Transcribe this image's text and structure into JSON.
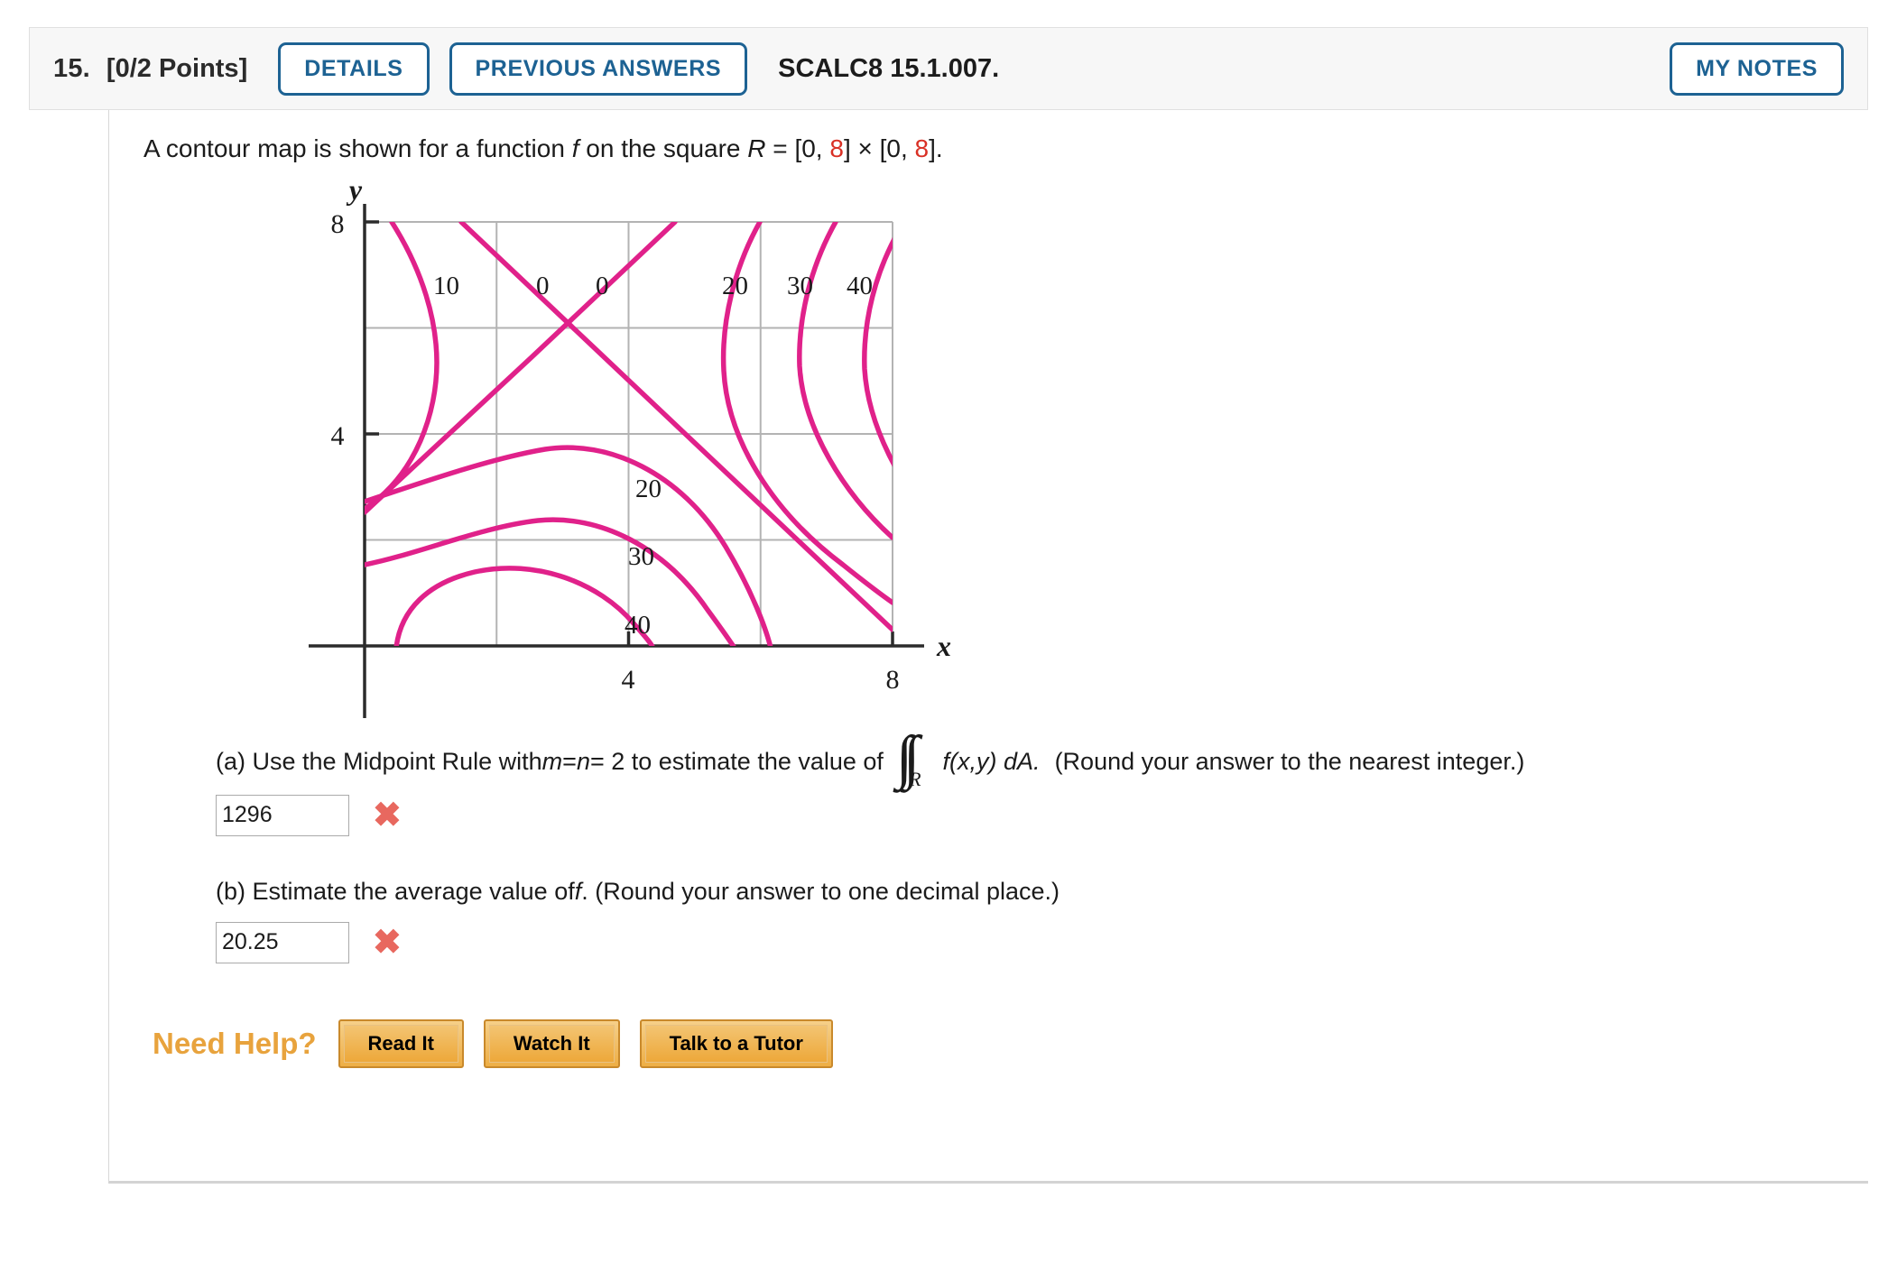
{
  "header": {
    "question_number": "15.",
    "points": "[0/2 Points]",
    "details_label": "DETAILS",
    "previous_answers_label": "PREVIOUS ANSWERS",
    "textbook_code": "SCALC8 15.1.007.",
    "my_notes_label": "MY NOTES"
  },
  "prompt": {
    "part1": "A contour map is shown for a function ",
    "f": "f",
    "part2": " on the square ",
    "R": "R",
    "eq": " = [0, ",
    "hi1": "8",
    "mid": "] × [0, ",
    "hi2": "8",
    "end": "]."
  },
  "chart_data": {
    "type": "contour",
    "title": "",
    "xlabel": "x",
    "ylabel": "y",
    "xlim": [
      0,
      8
    ],
    "ylim": [
      0,
      8
    ],
    "xticks": [
      4,
      8
    ],
    "yticks": [
      4,
      8
    ],
    "xtick_labels": [
      "4",
      "8"
    ],
    "ytick_labels": [
      "4",
      "8"
    ],
    "grid": true,
    "gridlines_x": [
      2,
      4,
      6
    ],
    "gridlines_y": [
      2,
      4,
      6
    ],
    "levels": [
      0,
      10,
      20,
      30,
      40
    ],
    "contour_color": "#e0218a",
    "grid_color": "#b0b0b0",
    "axis_color": "#333333",
    "top_labels": [
      {
        "text": "10",
        "x": 1.05,
        "y": 6.85
      },
      {
        "text": "0",
        "x": 2.55,
        "y": 6.85
      },
      {
        "text": "0",
        "x": 3.45,
        "y": 6.85
      },
      {
        "text": "20",
        "x": 5.4,
        "y": 6.85
      },
      {
        "text": "30",
        "x": 6.35,
        "y": 6.85
      },
      {
        "text": "40",
        "x": 7.25,
        "y": 6.85
      },
      {
        "text": "20",
        "x": 4.15,
        "y": 3.45
      },
      {
        "text": "30",
        "x": 4.05,
        "y": 2.45
      },
      {
        "text": "40",
        "x": 4.0,
        "y": 1.45
      }
    ],
    "description": "Saddle-shaped contour map with level curves 0, 10, 20, 30, 40 over the square [0,8]x[0,8]; values increase toward the lower-right and left edges."
  },
  "part_a": {
    "label": "(a) Use the Midpoint Rule with ",
    "m": "m",
    "eq1": " = ",
    "n": "n",
    "eq2": " = 2 to estimate the value of",
    "integral": "∫∫",
    "integral_sub": "R",
    "integrand": "f(x,y) dA.",
    "rounding": "(Round your answer to the nearest integer.)",
    "answer_value": "1296",
    "answer_placeholder": "",
    "status": "✖"
  },
  "part_b": {
    "label_1": "(b) Estimate the average value of ",
    "f": "f",
    "label_2": ". (Round your answer to one decimal place.)",
    "answer_value": "20.25",
    "answer_placeholder": "",
    "status": "✖"
  },
  "need_help": {
    "label": "Need Help?",
    "buttons": [
      "Read It",
      "Watch It",
      "Talk to a Tutor"
    ]
  },
  "colors": {
    "accent_blue": "#1d6293",
    "contour_pink": "#e0218a",
    "wrong_red": "#e8685f",
    "help_orange": "#e8a33d",
    "highlight_red": "#d93025"
  }
}
